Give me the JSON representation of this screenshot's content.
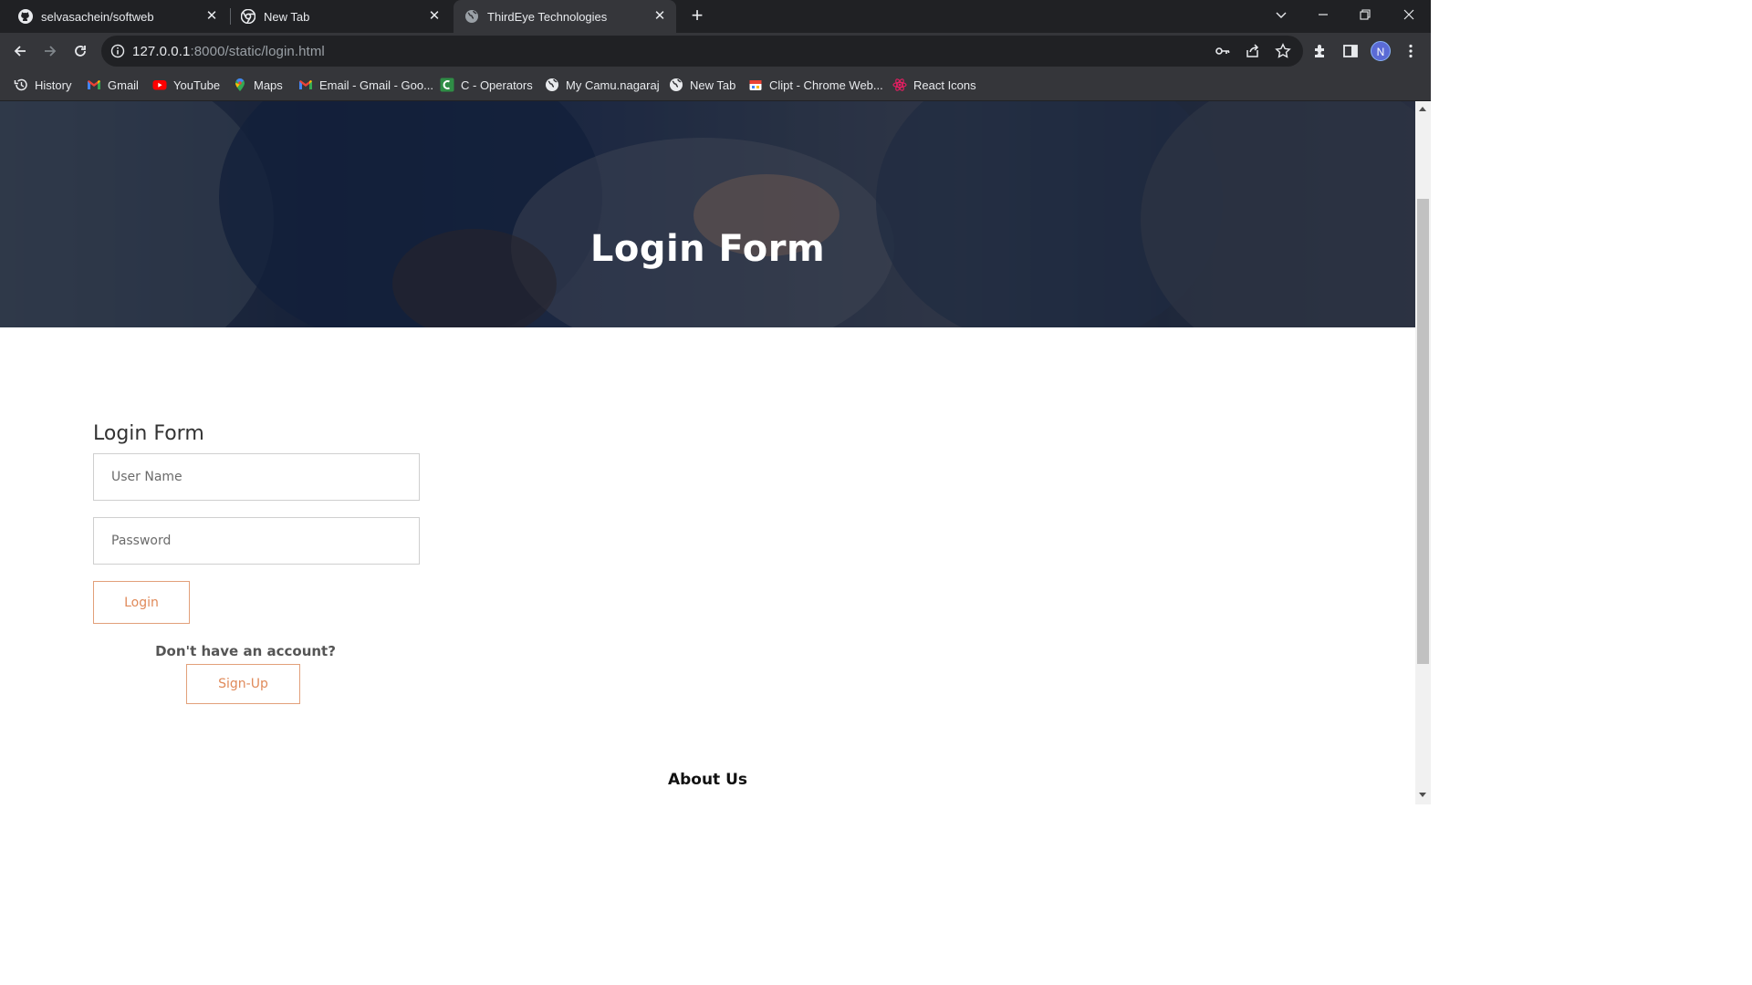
{
  "browser": {
    "tabs": [
      {
        "title": "selvasachein/softweb",
        "icon": "github-icon"
      },
      {
        "title": "New Tab",
        "icon": "chrome-icon"
      },
      {
        "title": "ThirdEye Technologies",
        "icon": "globe-icon"
      }
    ],
    "url_host": "127.0.0.1",
    "url_path": ":8000/static/login.html",
    "profile_initial": "N",
    "bookmarks": [
      {
        "label": "History",
        "icon": "history-icon"
      },
      {
        "label": "Gmail",
        "icon": "gmail-icon"
      },
      {
        "label": "YouTube",
        "icon": "youtube-icon"
      },
      {
        "label": "Maps",
        "icon": "maps-icon"
      },
      {
        "label": "Email - Gmail - Goo...",
        "icon": "gmail-icon"
      },
      {
        "label": "C - Operators",
        "icon": "c-operators-icon"
      },
      {
        "label": "My Camu.nagaraj",
        "icon": "globe-icon"
      },
      {
        "label": "New Tab",
        "icon": "globe-icon"
      },
      {
        "label": "Clipt - Chrome Web...",
        "icon": "clipt-icon"
      },
      {
        "label": "React Icons",
        "icon": "react-icon"
      }
    ]
  },
  "hero": {
    "title": "Login Form"
  },
  "login": {
    "heading": "Login Form",
    "username_placeholder": "User Name",
    "password_placeholder": "Password",
    "login_label": "Login",
    "no_account_text": "Don't have an account?",
    "signup_label": "Sign-Up"
  },
  "about": {
    "heading": "About Us"
  },
  "colors": {
    "accent": "#e08a5a",
    "chrome_dark": "#202124",
    "chrome_toolbar": "#35363a"
  }
}
